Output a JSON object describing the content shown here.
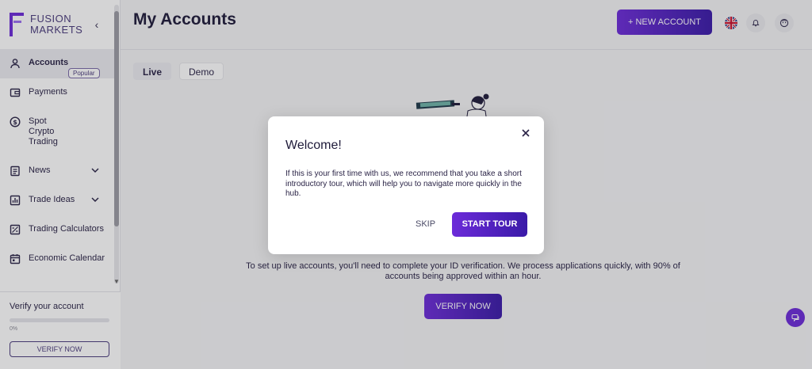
{
  "brand": {
    "line1": "FUSION",
    "line2": "MARKETS"
  },
  "sidebar": {
    "items": [
      {
        "label": "Accounts",
        "icon": "user-icon",
        "active": true
      },
      {
        "label": "Payments",
        "icon": "wallet-icon"
      },
      {
        "label": "Spot Crypto Trading",
        "icon": "dollar-icon",
        "badge": "Popular"
      },
      {
        "label": "News",
        "icon": "document-icon",
        "expandable": true
      },
      {
        "label": "Trade Ideas",
        "icon": "chart-icon",
        "expandable": true
      },
      {
        "label": "Trading Calculators",
        "icon": "calculator-icon"
      },
      {
        "label": "Economic Calendar",
        "icon": "calendar-icon"
      }
    ],
    "spot_line1": "Spot",
    "spot_line2": "Crypto",
    "spot_line3": "Trading",
    "verify": {
      "title": "Verify your account",
      "progress_text": "0%",
      "progress": 0,
      "button": "VERIFY NOW"
    }
  },
  "header": {
    "title": "My Accounts",
    "new_account": "+ NEW ACCOUNT"
  },
  "tabs": [
    {
      "label": "Live",
      "active": true
    },
    {
      "label": "Demo",
      "active": false
    }
  ],
  "main": {
    "info": "To set up live accounts, you'll need to complete your ID verification. We process applications quickly, with 90% of accounts being approved within an hour.",
    "verify_button": "VERIFY NOW"
  },
  "modal": {
    "title": "Welcome!",
    "body": "If this is your first time with us, we recommend that you take a short introductory tour, which will help you to navigate more quickly in the hub.",
    "skip": "SKIP",
    "start": "START TOUR"
  },
  "colors": {
    "accent": "#6c2bd9",
    "accent_dark": "#3a1aa8"
  }
}
